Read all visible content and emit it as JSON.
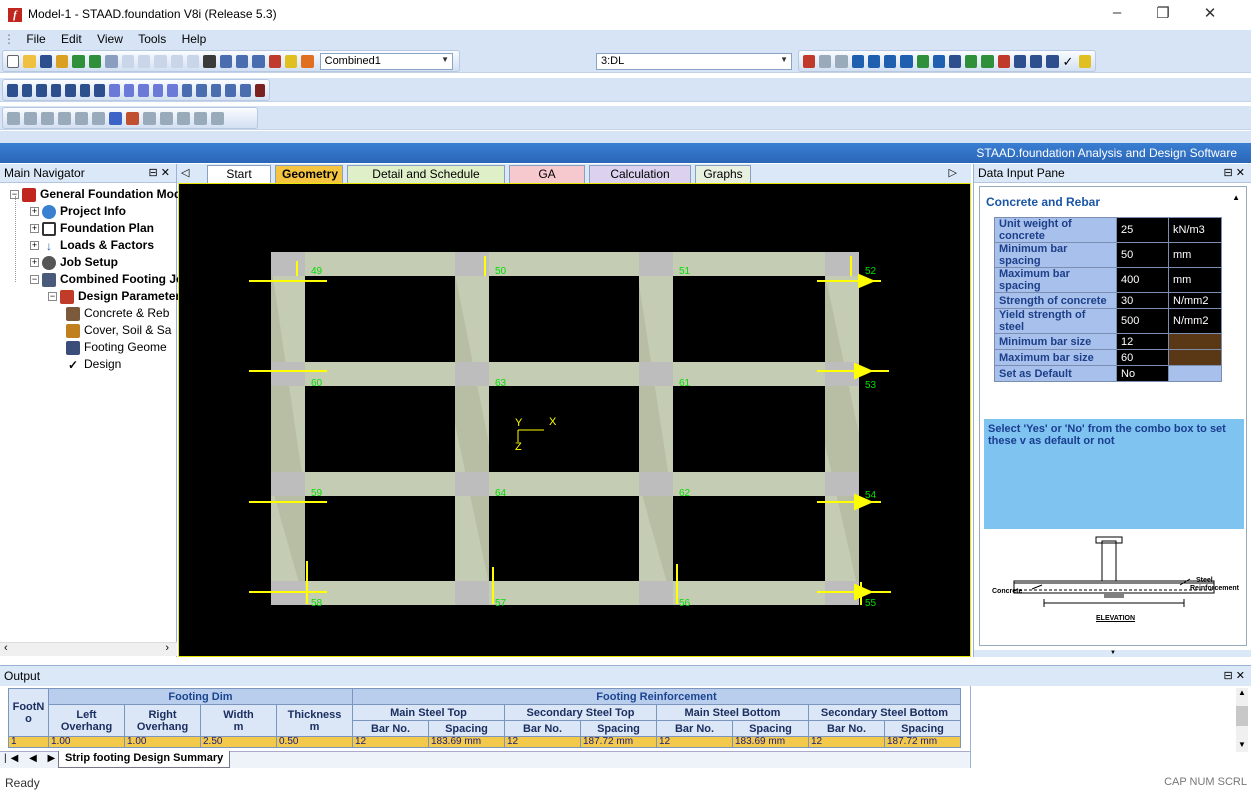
{
  "window": {
    "title": "Model-1 - STAAD.foundation V8i (Release 5.3)",
    "app_icon": "f",
    "minimize": "–",
    "maximize": "❐",
    "close": "✕"
  },
  "menu": [
    "File",
    "Edit",
    "View",
    "Tools",
    "Help"
  ],
  "toolbar": {
    "load_combo": "Combined1",
    "case_combo": "3:DL"
  },
  "brand": "STAAD.foundation Analysis and Design Software",
  "nav": {
    "title": "Main Navigator",
    "pin": "⊟ ✕",
    "items": [
      {
        "label": "General Foundation Mod",
        "bold": true
      },
      {
        "label": "Project Info",
        "bold": true
      },
      {
        "label": "Foundation Plan",
        "bold": true
      },
      {
        "label": "Loads & Factors",
        "bold": true
      },
      {
        "label": "Job Setup",
        "bold": true
      },
      {
        "label": "Combined Footing Jol",
        "bold": true
      },
      {
        "label": "Design Parameter",
        "bold": true
      },
      {
        "label": "Concrete & Reb",
        "bold": false
      },
      {
        "label": "Cover, Soil & Sa",
        "bold": false
      },
      {
        "label": "Footing Geome",
        "bold": false
      },
      {
        "label": "Design",
        "bold": false
      }
    ]
  },
  "tabs": [
    "Start Page",
    "Geometry",
    "Detail and Schedule Drawing",
    "GA Drawing",
    "Calculation Sheet",
    "Graphs"
  ],
  "tab_colors": [
    "#ffffff",
    "#f5c542",
    "#dff0c8",
    "#f6c9cf",
    "#dcd2f0",
    "#e8f0e0"
  ],
  "canvas": {
    "axis_y": "Y",
    "axis_x": "X",
    "axis_z": "Z",
    "nodes": [
      "49",
      "50",
      "51",
      "52",
      "60",
      "63",
      "61",
      "53",
      "59",
      "64",
      "62",
      "54",
      "58",
      "57",
      "56",
      "55"
    ]
  },
  "data_input": {
    "title": "Data Input Pane",
    "pin": "⊟ ✕",
    "section": "Concrete and Rebar",
    "rows": [
      {
        "label": "Unit weight of concrete",
        "value": "25",
        "unit": "kN/m3"
      },
      {
        "label": "Minimum bar spacing",
        "value": "50",
        "unit": "mm"
      },
      {
        "label": "Maximum bar spacing",
        "value": "400",
        "unit": "mm"
      },
      {
        "label": "Strength of concrete",
        "value": "30",
        "unit": "N/mm2"
      },
      {
        "label": "Yield strength of steel",
        "value": "500",
        "unit": "N/mm2"
      },
      {
        "label": "Minimum bar size",
        "value": "12",
        "unit": ""
      },
      {
        "label": "Maximum bar size",
        "value": "60",
        "unit": ""
      },
      {
        "label": "Set as Default",
        "value": "No",
        "unit": ""
      }
    ],
    "help": "Select 'Yes' or 'No' from the combo box to set these v as default or not",
    "elevation": {
      "concrete": "Concrete",
      "steel": "Steel",
      "reinf": "Reinforcement",
      "title": "ELEVATION"
    }
  },
  "output": {
    "title": "Output",
    "pin": "⊟ ✕",
    "col_footno": "FootN o",
    "group_dim": "Footing Dim",
    "group_reinf": "Footing Reinforcement",
    "dim_cols": [
      [
        "Left",
        "Overhang"
      ],
      [
        "Right",
        "Overhang"
      ],
      [
        "Width",
        "m"
      ],
      [
        "Thickness",
        "m"
      ]
    ],
    "reinf_groups": [
      "Main Steel Top",
      "Secondary Steel Top",
      "Main Steel Bottom",
      "Secondary Steel Bottom"
    ],
    "reinf_sub": [
      "Bar No.",
      "Spacing"
    ],
    "row": [
      "1",
      "1.00",
      "1.00",
      "2.50",
      "0.50",
      "12",
      "183.69 mm",
      "12",
      "187.72 mm",
      "12",
      "183.69 mm",
      "12",
      "187.72 mm"
    ],
    "sheet_tab": "Strip footing Design Summary",
    "nav_arrows": "|◀ ◀ ▶ ▶|"
  },
  "status": {
    "left": "Ready",
    "right": "CAP NUM SCRL"
  }
}
